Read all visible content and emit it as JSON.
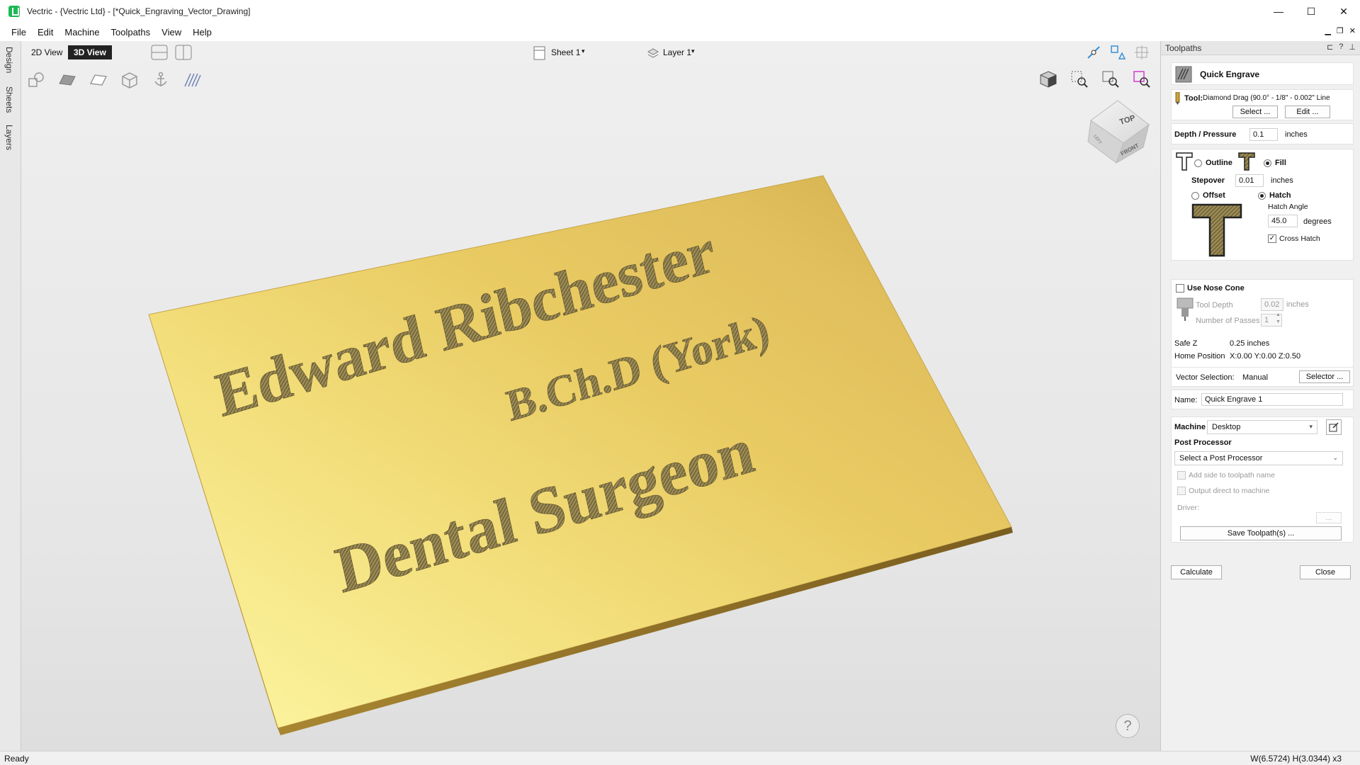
{
  "window": {
    "title": "Vectric - {Vectric Ltd} - [*Quick_Engraving_Vector_Drawing]",
    "controls": {
      "minimize": "—",
      "maximize": "☐",
      "close": "✕"
    }
  },
  "menu": [
    "File",
    "Edit",
    "Machine",
    "Toolpaths",
    "View",
    "Help"
  ],
  "left_tabs": [
    "Design",
    "Sheets",
    "Layers"
  ],
  "view_tabs": {
    "view2d": "2D View",
    "view3d": "3D View"
  },
  "sheet_label": "Sheet 1",
  "layer_label": "Layer 1",
  "view_cube": {
    "top": "TOP",
    "front": "FRONT",
    "left": "LEFT"
  },
  "plaque": {
    "line1": "Edward Ribchester",
    "line2": "B.Ch.D (York)",
    "line3": "Dental Surgeon",
    "colors": {
      "gold_light": "#fbf29a",
      "gold_mid": "#e9c85a",
      "gold_dark": "#b58c2f",
      "edge": "#8a6b23"
    }
  },
  "help_glyph": "?",
  "panel": {
    "header": "Toolpaths",
    "title": "Quick Engrave",
    "tool_label": "Tool:",
    "tool_value": "Diamond Drag (90.0° - 1/8\" - 0.002\" Line",
    "select_btn": "Select ...",
    "edit_btn": "Edit ...",
    "depth_label": "Depth / Pressure",
    "depth_value": "0.1",
    "depth_unit": "inches",
    "outline_label": "Outline",
    "fill_label": "Fill",
    "stepover_label": "Stepover",
    "stepover_value": "0.01",
    "stepover_unit": "inches",
    "offset_label": "Offset",
    "hatch_label": "Hatch",
    "hatch_angle_label": "Hatch Angle",
    "hatch_angle_value": "45.0",
    "hatch_angle_unit": "degrees",
    "cross_hatch_label": "Cross Hatch",
    "nose_cone_label": "Use Nose Cone",
    "tool_depth_label": "Tool Depth",
    "tool_depth_value": "0.02",
    "tool_depth_unit": "inches",
    "passes_label": "Number of Passes",
    "passes_value": "1",
    "safe_z_label": "Safe Z",
    "safe_z_value": "0.25 inches",
    "home_label": "Home Position",
    "home_value": "X:0.00 Y:0.00 Z:0.50",
    "vector_sel_label": "Vector Selection:",
    "vector_sel_value": "Manual",
    "selector_btn": "Selector ...",
    "name_label": "Name:",
    "name_value": "Quick Engrave 1",
    "machine_label": "Machine",
    "machine_value": "Desktop",
    "post_label": "Post Processor",
    "post_placeholder": "Select a Post Processor",
    "add_side_label": "Add side to toolpath name",
    "output_direct_label": "Output direct to machine",
    "driver_label": "Driver:",
    "driver_btn": "...",
    "save_btn": "Save Toolpath(s) ...",
    "calculate_btn": "Calculate",
    "close_btn": "Close"
  },
  "status": {
    "left": "Ready",
    "right": "W(6.5724) H(3.0344) x3"
  }
}
